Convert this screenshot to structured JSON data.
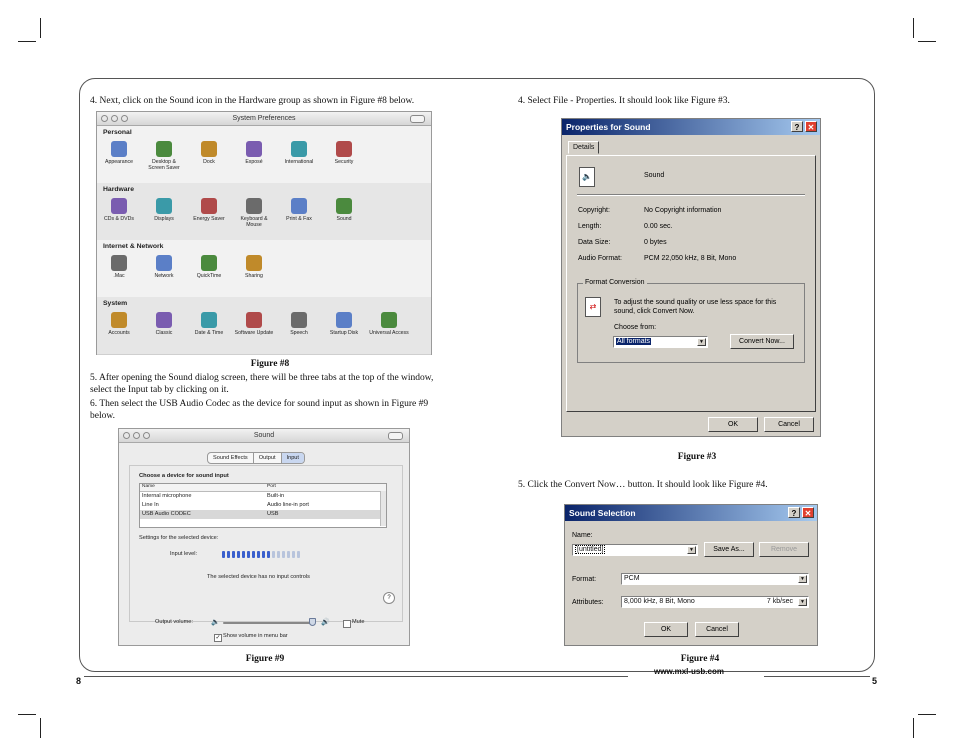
{
  "left_page": {
    "step4": "4. Next, click on the Sound icon in the Hardware group as shown in Figure #8 below.",
    "figure8_caption": "Figure #8",
    "step5": "5. After opening the Sound dialog screen, there will be three tabs at the top of the window, select the Input tab by clicking on it.",
    "step6": "6. Then select the USB Audio Codec as the device for sound input as shown in Figure #9 below.",
    "figure9_caption": "Figure #9",
    "page_number": "8"
  },
  "right_page": {
    "step4": "4. Select File - Properties. It should look like Figure #3.",
    "figure3_caption": "Figure #3",
    "step5": "5. Click the Convert Now… button. It should look like Figure #4.",
    "figure4_caption": "Figure #4",
    "website": "www.mxl-usb.com",
    "page_number": "5"
  },
  "sys_prefs": {
    "title": "System Preferences",
    "sections": [
      {
        "name": "Personal",
        "items": [
          "Appearance",
          "Desktop & Screen Saver",
          "Dock",
          "Exposé",
          "International",
          "Security"
        ]
      },
      {
        "name": "Hardware",
        "items": [
          "CDs & DVDs",
          "Displays",
          "Energy Saver",
          "Keyboard & Mouse",
          "Print & Fax",
          "Sound"
        ]
      },
      {
        "name": "Internet & Network",
        "items": [
          ".Mac",
          "Network",
          "QuickTime",
          "Sharing"
        ]
      },
      {
        "name": "System",
        "items": [
          "Accounts",
          "Classic",
          "Date & Time",
          "Software Update",
          "Speech",
          "Startup Disk",
          "Universal Access"
        ]
      }
    ]
  },
  "sound_window": {
    "title": "Sound",
    "tabs": [
      "Sound Effects",
      "Output",
      "Input"
    ],
    "choose_label": "Choose a device for sound input",
    "columns": [
      "Name",
      "Port"
    ],
    "rows": [
      {
        "name": "Internal microphone",
        "port": "Built-in"
      },
      {
        "name": "Line In",
        "port": "Audio line-in port"
      },
      {
        "name": "USB Audio CODEC",
        "port": "USB"
      }
    ],
    "settings_label": "Settings for the selected device:",
    "input_level_label": "Input level:",
    "no_controls": "The selected device has no input controls",
    "help": "?",
    "output_volume_label": "Output volume:",
    "mute_label": "Mute",
    "show_volume_label": "Show volume in menu bar"
  },
  "properties_dialog": {
    "title": "Properties for Sound",
    "help": "?",
    "close": "✕",
    "tab": "Details",
    "file_name": "Sound",
    "copyright_label": "Copyright:",
    "copyright_value": "No Copyright information",
    "length_label": "Length:",
    "length_value": "0.00 sec.",
    "data_size_label": "Data Size:",
    "data_size_value": "0 bytes",
    "audio_format_label": "Audio Format:",
    "audio_format_value": "PCM 22,050 kHz, 8 Bit, Mono",
    "group_label": "Format Conversion",
    "conversion_text": "To adjust the sound quality or use less space for this sound, click Convert Now.",
    "choose_from_label": "Choose from:",
    "choose_from_value": "All formats",
    "convert_button": "Convert Now...",
    "ok": "OK",
    "cancel": "Cancel"
  },
  "sound_selection_dialog": {
    "title": "Sound Selection",
    "help": "?",
    "close": "✕",
    "name_label": "Name:",
    "name_value": "[untitled]",
    "save_as": "Save As...",
    "remove": "Remove",
    "format_label": "Format:",
    "format_value": "PCM",
    "attributes_label": "Attributes:",
    "attributes_value": "8,000 kHz, 8 Bit, Mono",
    "attributes_rate": "7 kb/sec",
    "ok": "OK",
    "cancel": "Cancel"
  },
  "colors": {
    "win_title_start": "#0a246a",
    "win_title_end": "#a6caf0",
    "win_face": "#d4d0c8",
    "mac_selection": "#d8d8d8",
    "level_blue": "#3a5fcd"
  }
}
